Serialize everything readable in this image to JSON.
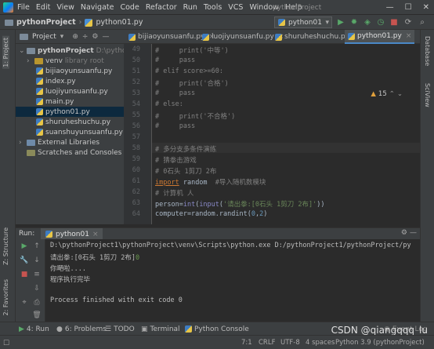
{
  "menubar": {
    "items": [
      "File",
      "Edit",
      "View",
      "Navigate",
      "Code",
      "Refactor",
      "Run",
      "Tools",
      "VCS",
      "Window",
      "Help"
    ],
    "app_title": "pythonProject"
  },
  "navbar": {
    "project": "pythonProject",
    "file": "python01.py",
    "run_config": "python01"
  },
  "project_panel": {
    "title": "Project",
    "root_name": "pythonProject",
    "root_path": "D:\\pythonPr",
    "venv": "venv",
    "venv_note": "library root",
    "files": [
      "bijiaoyunsuanfu.py",
      "index.py",
      "luojiyunsuanfu.py",
      "main.py",
      "python01.py",
      "shuruheshuchu.py",
      "suanshuyunsuanfu.py"
    ],
    "external": "External Libraries",
    "scratches": "Scratches and Consoles"
  },
  "tabs": [
    "bijiaoyunsuanfu.py",
    "luojiyunsuanfu.py",
    "shuruheshuchu.py",
    "python01.py"
  ],
  "editor": {
    "warning_count": "15",
    "lines": [
      {
        "n": "49",
        "t": "#     print('中等')",
        "c": "cm"
      },
      {
        "n": "50",
        "t": "#     pass",
        "c": "cm"
      },
      {
        "n": "51",
        "t": "# elif score>=60:",
        "c": "cm"
      },
      {
        "n": "52",
        "t": "#     print('合格')",
        "c": "cm"
      },
      {
        "n": "53",
        "t": "#     pass",
        "c": "cm"
      },
      {
        "n": "54",
        "t": "# else:",
        "c": "cm"
      },
      {
        "n": "55",
        "t": "#     print('不合格')",
        "c": "cm"
      },
      {
        "n": "56",
        "t": "#     pass",
        "c": "cm"
      },
      {
        "n": "57",
        "t": "",
        "c": ""
      },
      {
        "n": "58",
        "t": "# 多分支多条件演练",
        "c": "cm"
      },
      {
        "n": "59",
        "t": "# 猜拳击游戏",
        "c": "cm"
      },
      {
        "n": "60",
        "t": "# 0石头 1剪刀 2布",
        "c": "cm"
      },
      {
        "n": "61",
        "t": "",
        "c": "import"
      },
      {
        "n": "62",
        "t": "# 计算机 人",
        "c": "cm"
      },
      {
        "n": "63",
        "t": "",
        "c": "person"
      },
      {
        "n": "64",
        "t": "",
        "c": "computer"
      }
    ],
    "import_kw": "import",
    "import_mod": " random  ",
    "import_comment": "#导入随机数模块",
    "person_a": "person=",
    "person_b": "int",
    "person_c": "(",
    "person_d": "input",
    "person_e": "(",
    "person_f": "'请出拳:[0石头 1剪刀 2布]'",
    "person_g": "))",
    "computer_a": "computer=random.randint(",
    "computer_b": "0",
    "computer_c": ",",
    "computer_d": "2",
    "computer_e": ")"
  },
  "run_panel": {
    "label": "Run:",
    "tab": "python01",
    "console": [
      "D:\\pythonProject1\\pythonProject\\venv\\Scripts\\python.exe D:/pythonProject1/pythonProject/py",
      "请出拳:[0石头 1剪刀 2布]",
      "你嗮啦....",
      "程序执行完毕",
      "",
      "Process finished with exit code 0"
    ],
    "input_echo": "0"
  },
  "bottom_tabs": [
    "4: Run",
    "6: Problems",
    "TODO",
    "Terminal",
    "Python Console"
  ],
  "left_strip": [
    "1: Project",
    "Z: Structure",
    "2: Favorites"
  ],
  "right_strip": [
    "Database",
    "SciView"
  ],
  "status": {
    "position": "7:1",
    "line_sep": "CRLF",
    "encoding": "UTF-8",
    "indent": "4 spaces",
    "interpreter": "Python 3.9 (pythonProject)"
  },
  "watermark": "CSDN @qiangqqq_lu",
  "event_log": "Event Log"
}
